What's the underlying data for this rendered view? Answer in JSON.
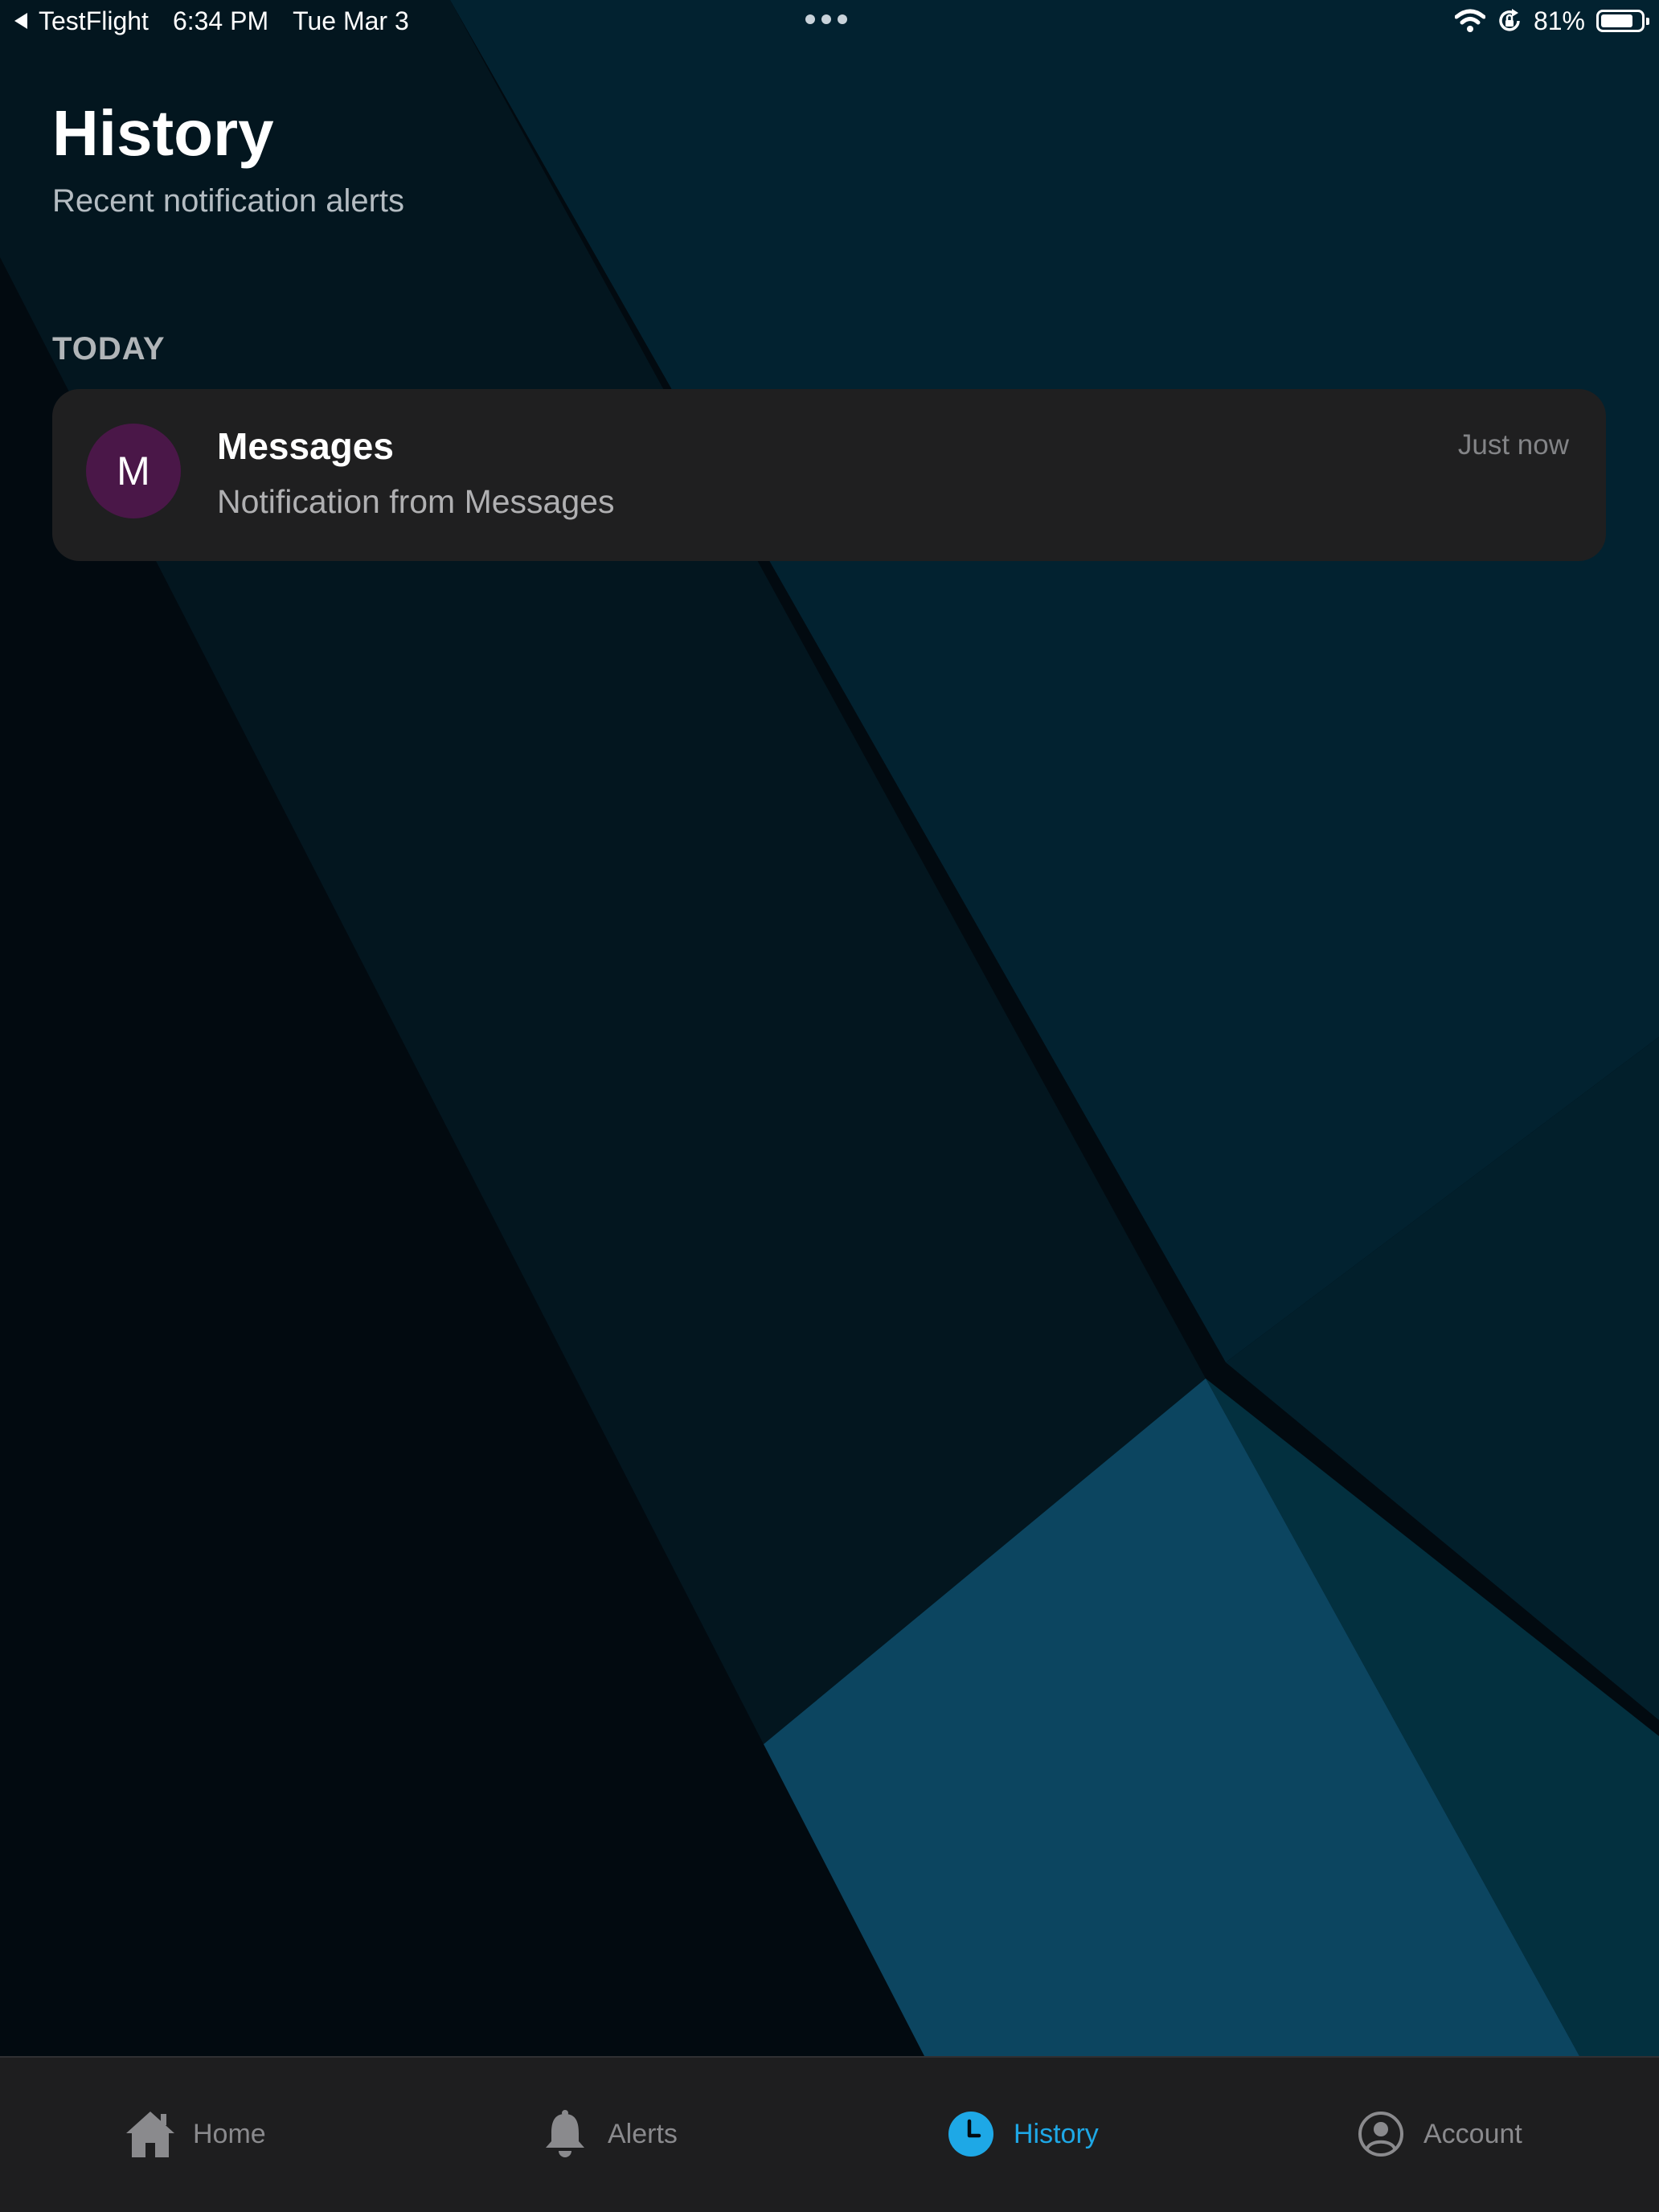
{
  "status_bar": {
    "back_app": "TestFlight",
    "time": "6:34 PM",
    "date": "Tue Mar 3",
    "battery_percent_label": "81%",
    "battery_level": 0.81,
    "icons": [
      "back-arrow-icon",
      "more-dots-icon",
      "wifi-icon",
      "orientation-lock-icon",
      "battery-icon"
    ]
  },
  "header": {
    "title": "History",
    "subtitle": "Recent notification alerts"
  },
  "sections": [
    {
      "label": "TODAY",
      "items": [
        {
          "avatar_letter": "M",
          "avatar_color": "#4a1748",
          "title": "Messages",
          "body": "Notification from Messages",
          "time": "Just now"
        }
      ]
    }
  ],
  "tab_bar": {
    "active_color": "#1ea8e6",
    "inactive_color": "#8a8a8d",
    "tabs": [
      {
        "label": "Home",
        "icon": "home-icon",
        "active": false
      },
      {
        "label": "Alerts",
        "icon": "bell-icon",
        "active": false
      },
      {
        "label": "History",
        "icon": "clock-icon",
        "active": true
      },
      {
        "label": "Account",
        "icon": "account-icon",
        "active": false
      }
    ]
  },
  "colors": {
    "card_background": "#1f1f20",
    "tab_bar_background": "#1e1e1f",
    "wallpaper_dark": "#020a10",
    "wallpaper_teal": "#0c4560"
  }
}
